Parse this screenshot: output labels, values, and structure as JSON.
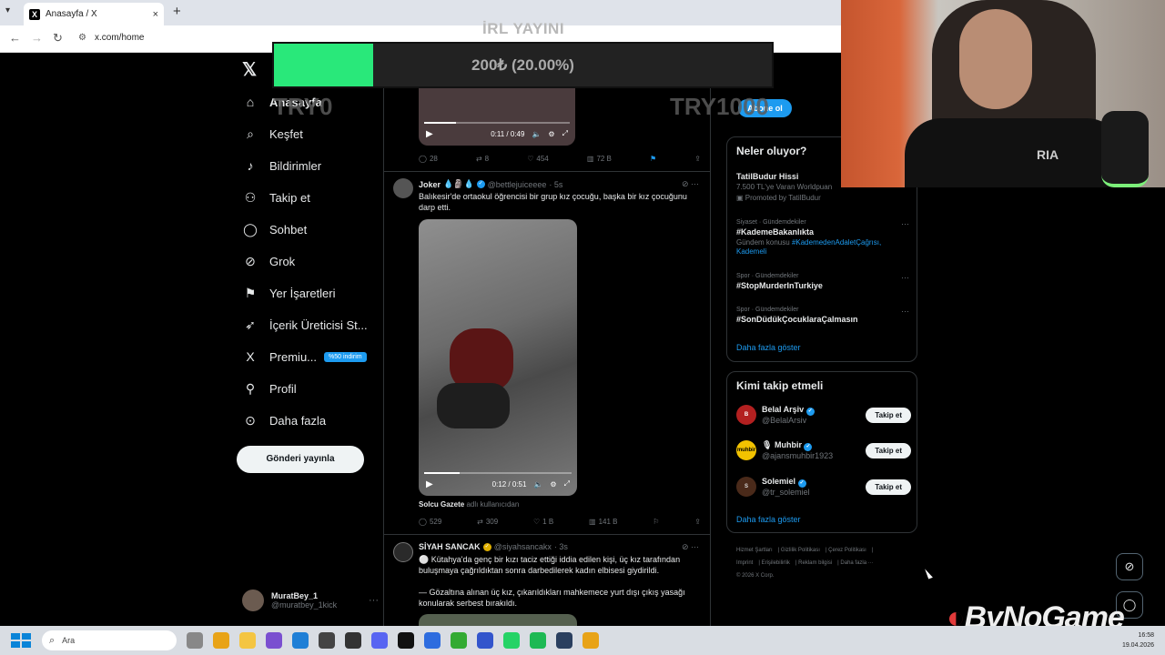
{
  "browser": {
    "tab_title": "Anasayfa / X",
    "url": "x.com/home",
    "new_tab": "+",
    "close": "×"
  },
  "overlay": {
    "irl_label": "İRL YAYINI",
    "donation_text": "200₺ (20.00%)",
    "donation_progress": 0.2,
    "min_label": "TRY0",
    "max_label": "TRY1000",
    "brand": "ByNoGame"
  },
  "webcam": {
    "shirt_text": "RIA"
  },
  "sidebar": {
    "items": [
      {
        "label": "Anasayfa",
        "icon": "⌂",
        "name": "home"
      },
      {
        "label": "Keşfet",
        "icon": "⌕",
        "name": "explore"
      },
      {
        "label": "Bildirimler",
        "icon": "♪",
        "name": "notifications"
      },
      {
        "label": "Takip et",
        "icon": "⚇",
        "name": "follow"
      },
      {
        "label": "Sohbet",
        "icon": "◯",
        "name": "chat"
      },
      {
        "label": "Grok",
        "icon": "⊘",
        "name": "grok"
      },
      {
        "label": "Yer İşaretleri",
        "icon": "⚑",
        "name": "bookmarks"
      },
      {
        "label": "İçerik Üreticisi St...",
        "icon": "➶",
        "name": "creator-studio"
      },
      {
        "label": "Premiu...",
        "icon": "X",
        "name": "premium"
      },
      {
        "label": "Profil",
        "icon": "⚲",
        "name": "profile"
      },
      {
        "label": "Daha fazla",
        "icon": "⊙",
        "name": "more"
      }
    ],
    "premium_badge": "%50 indirim",
    "post_button": "Gönderi yayınla",
    "account": {
      "name": "MuratBey_1",
      "handle": "@muratbey_1kick"
    }
  },
  "feed": {
    "tweet0": {
      "video_time": "0:11 / 0:49",
      "progress": 0.22,
      "replies": "28",
      "reposts": "8",
      "likes": "454",
      "views": "72 B"
    },
    "tweet1": {
      "name": "Joker",
      "emojis": "💧🗿💧",
      "handle": "@bettlejuiceeee",
      "time": "· 5s",
      "text": "Balıkesir'de ortaokul öğrencisi bir grup kız çocuğu, başka bir kız çocuğunu darp etti.",
      "video_time": "0:12 / 0:51",
      "progress": 0.24,
      "source_name": "Solcu Gazete",
      "source_suffix": "adlı kullanıcıdan",
      "replies": "529",
      "reposts": "309",
      "likes": "1 B",
      "views": "141 B"
    },
    "tweet2": {
      "name": "SİYAH SANCAK",
      "handle": "@siyahsancakx",
      "time": "· 3s",
      "text1": "⚪ Kütahya'da genç bir kızı taciz ettiği iddia edilen kişi, üç kız tarafından buluşmaya çağrıldıktan sonra darbedilerek kadın elbisesi giydirildi.",
      "text2": "— Gözaltına alınan üç kız, çıkarıldıkları mahkemece yurt dışı çıkış yasağı konularak serbest bırakıldı."
    }
  },
  "right": {
    "subscribe": "Abone ol",
    "trends_title": "Neler oluyor?",
    "trends": [
      {
        "category": "",
        "title": "TatilBudur Hissi",
        "sub": "7.500 TL'ye Varan Worldpuan",
        "promoted": "Promoted by TatilBudur"
      },
      {
        "category": "Siyaset · Gündemdekiler",
        "title": "#KademeBakanlıkta",
        "sub_prefix": "Gündem konusu",
        "sub_highlight": "#KademedenAdaletÇağrısı, Kademeli"
      },
      {
        "category": "Spor · Gündemdekiler",
        "title": "#StopMurderInTurkiye"
      },
      {
        "category": "Spor · Gündemdekiler",
        "title": "#SonDüdükÇocuklaraÇalmasın"
      }
    ],
    "show_more": "Daha fazla göster",
    "who_title": "Kimi takip etmeli",
    "who": [
      {
        "name": "Belal Arşiv",
        "handle": "@BelalArsiv",
        "follow": "Takip et",
        "avatar_color": "#b32020"
      },
      {
        "name": "Muhbir",
        "prefix": "🎙",
        "handle": "@ajansmuhbir1923",
        "follow": "Takip et",
        "avatar_color": "#f2c200",
        "avatar_text": "muhbir"
      },
      {
        "name": "Solemiel",
        "handle": "@tr_solemiel",
        "follow": "Takip et",
        "avatar_color": "#4a2a1a"
      }
    ],
    "footer": [
      "Hizmet Şartları",
      "Gizlilik Politikası",
      "Çerez Politikası",
      "Imprint",
      "Erişilebilirlik",
      "Reklam bilgisi",
      "Daha fazla ···",
      "© 2026 X Corp."
    ]
  },
  "taskbar": {
    "search_placeholder": "Ara",
    "time": "16:58",
    "date": "19.04.2026"
  },
  "colors": {
    "accent": "#1d9bf0",
    "donation_fill": "#29e87a",
    "brand_red": "#e23a3a"
  }
}
